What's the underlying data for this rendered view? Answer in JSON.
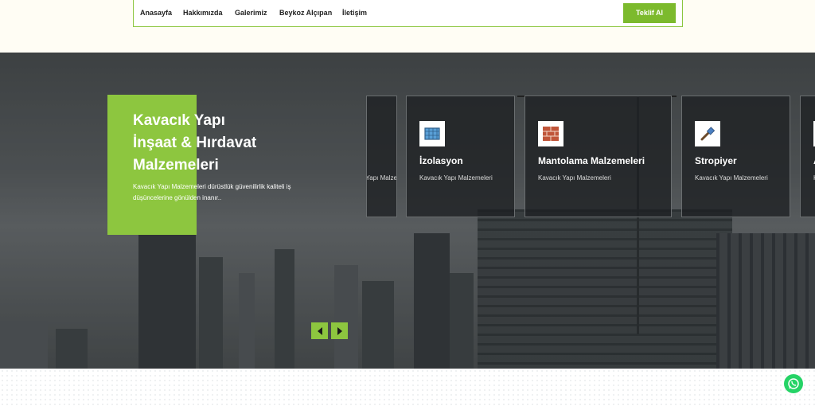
{
  "nav": {
    "items": [
      "Anasayfa",
      "Hakkımızda",
      "Galerimiz",
      "Beykoz Alçıpan",
      "İletişim"
    ],
    "cta_label": "Teklif Al"
  },
  "hero": {
    "title_lines": [
      "Kavacık Yapı",
      "İnşaat & Hırdavat",
      "Malzemeleri"
    ],
    "description_lines": [
      "Kavacık Yapı Malzemeleri dürüstlük güvenilirlik kaliteli iş",
      "düşüncelerine gönülden inanır.."
    ]
  },
  "cards": [
    {
      "name": "",
      "subtitle": "Kavacık Yapı Malzemeleri",
      "icon": "partial-card"
    },
    {
      "name": "İzolasyon",
      "subtitle": "Kavacık Yapı Malzemeleri",
      "icon": "insulation-icon"
    },
    {
      "name": "Mantolama Malzemeleri",
      "subtitle": "Kavacık Yapı Malzemeleri",
      "icon": "brick-wall-icon"
    },
    {
      "name": "Stropiyer",
      "subtitle": "Kavacık Yapı Malzemeleri",
      "icon": "paint-brush-icon"
    },
    {
      "name": "A",
      "subtitle": "Ka",
      "icon": "partial-card"
    }
  ],
  "colors": {
    "accent": "#8dc63f",
    "cta": "#7cba2d",
    "whatsapp": "#25d366"
  },
  "icons": {
    "prev": "chevron-left-icon",
    "next": "chevron-right-icon",
    "whatsapp": "whatsapp-icon"
  }
}
